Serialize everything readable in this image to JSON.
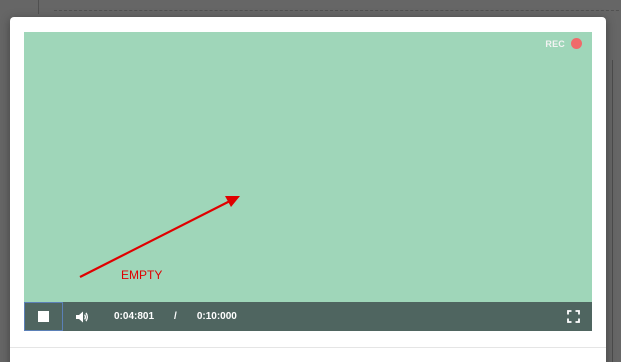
{
  "player": {
    "rec_label": "REC",
    "current_time": "0:04:801",
    "separator": "/",
    "total_time": "0:10:000",
    "background_color": "#9fd6b9",
    "controls_color": "#4f6560",
    "rec_dot_color": "#f06a6a"
  },
  "annotation": {
    "label": "EMPTY",
    "color": "#e00000"
  },
  "icons": {
    "stop": "stop-icon",
    "volume": "volume-icon",
    "fullscreen": "fullscreen-icon",
    "record": "record-dot-icon",
    "arrow": "annotation-arrow-icon"
  }
}
